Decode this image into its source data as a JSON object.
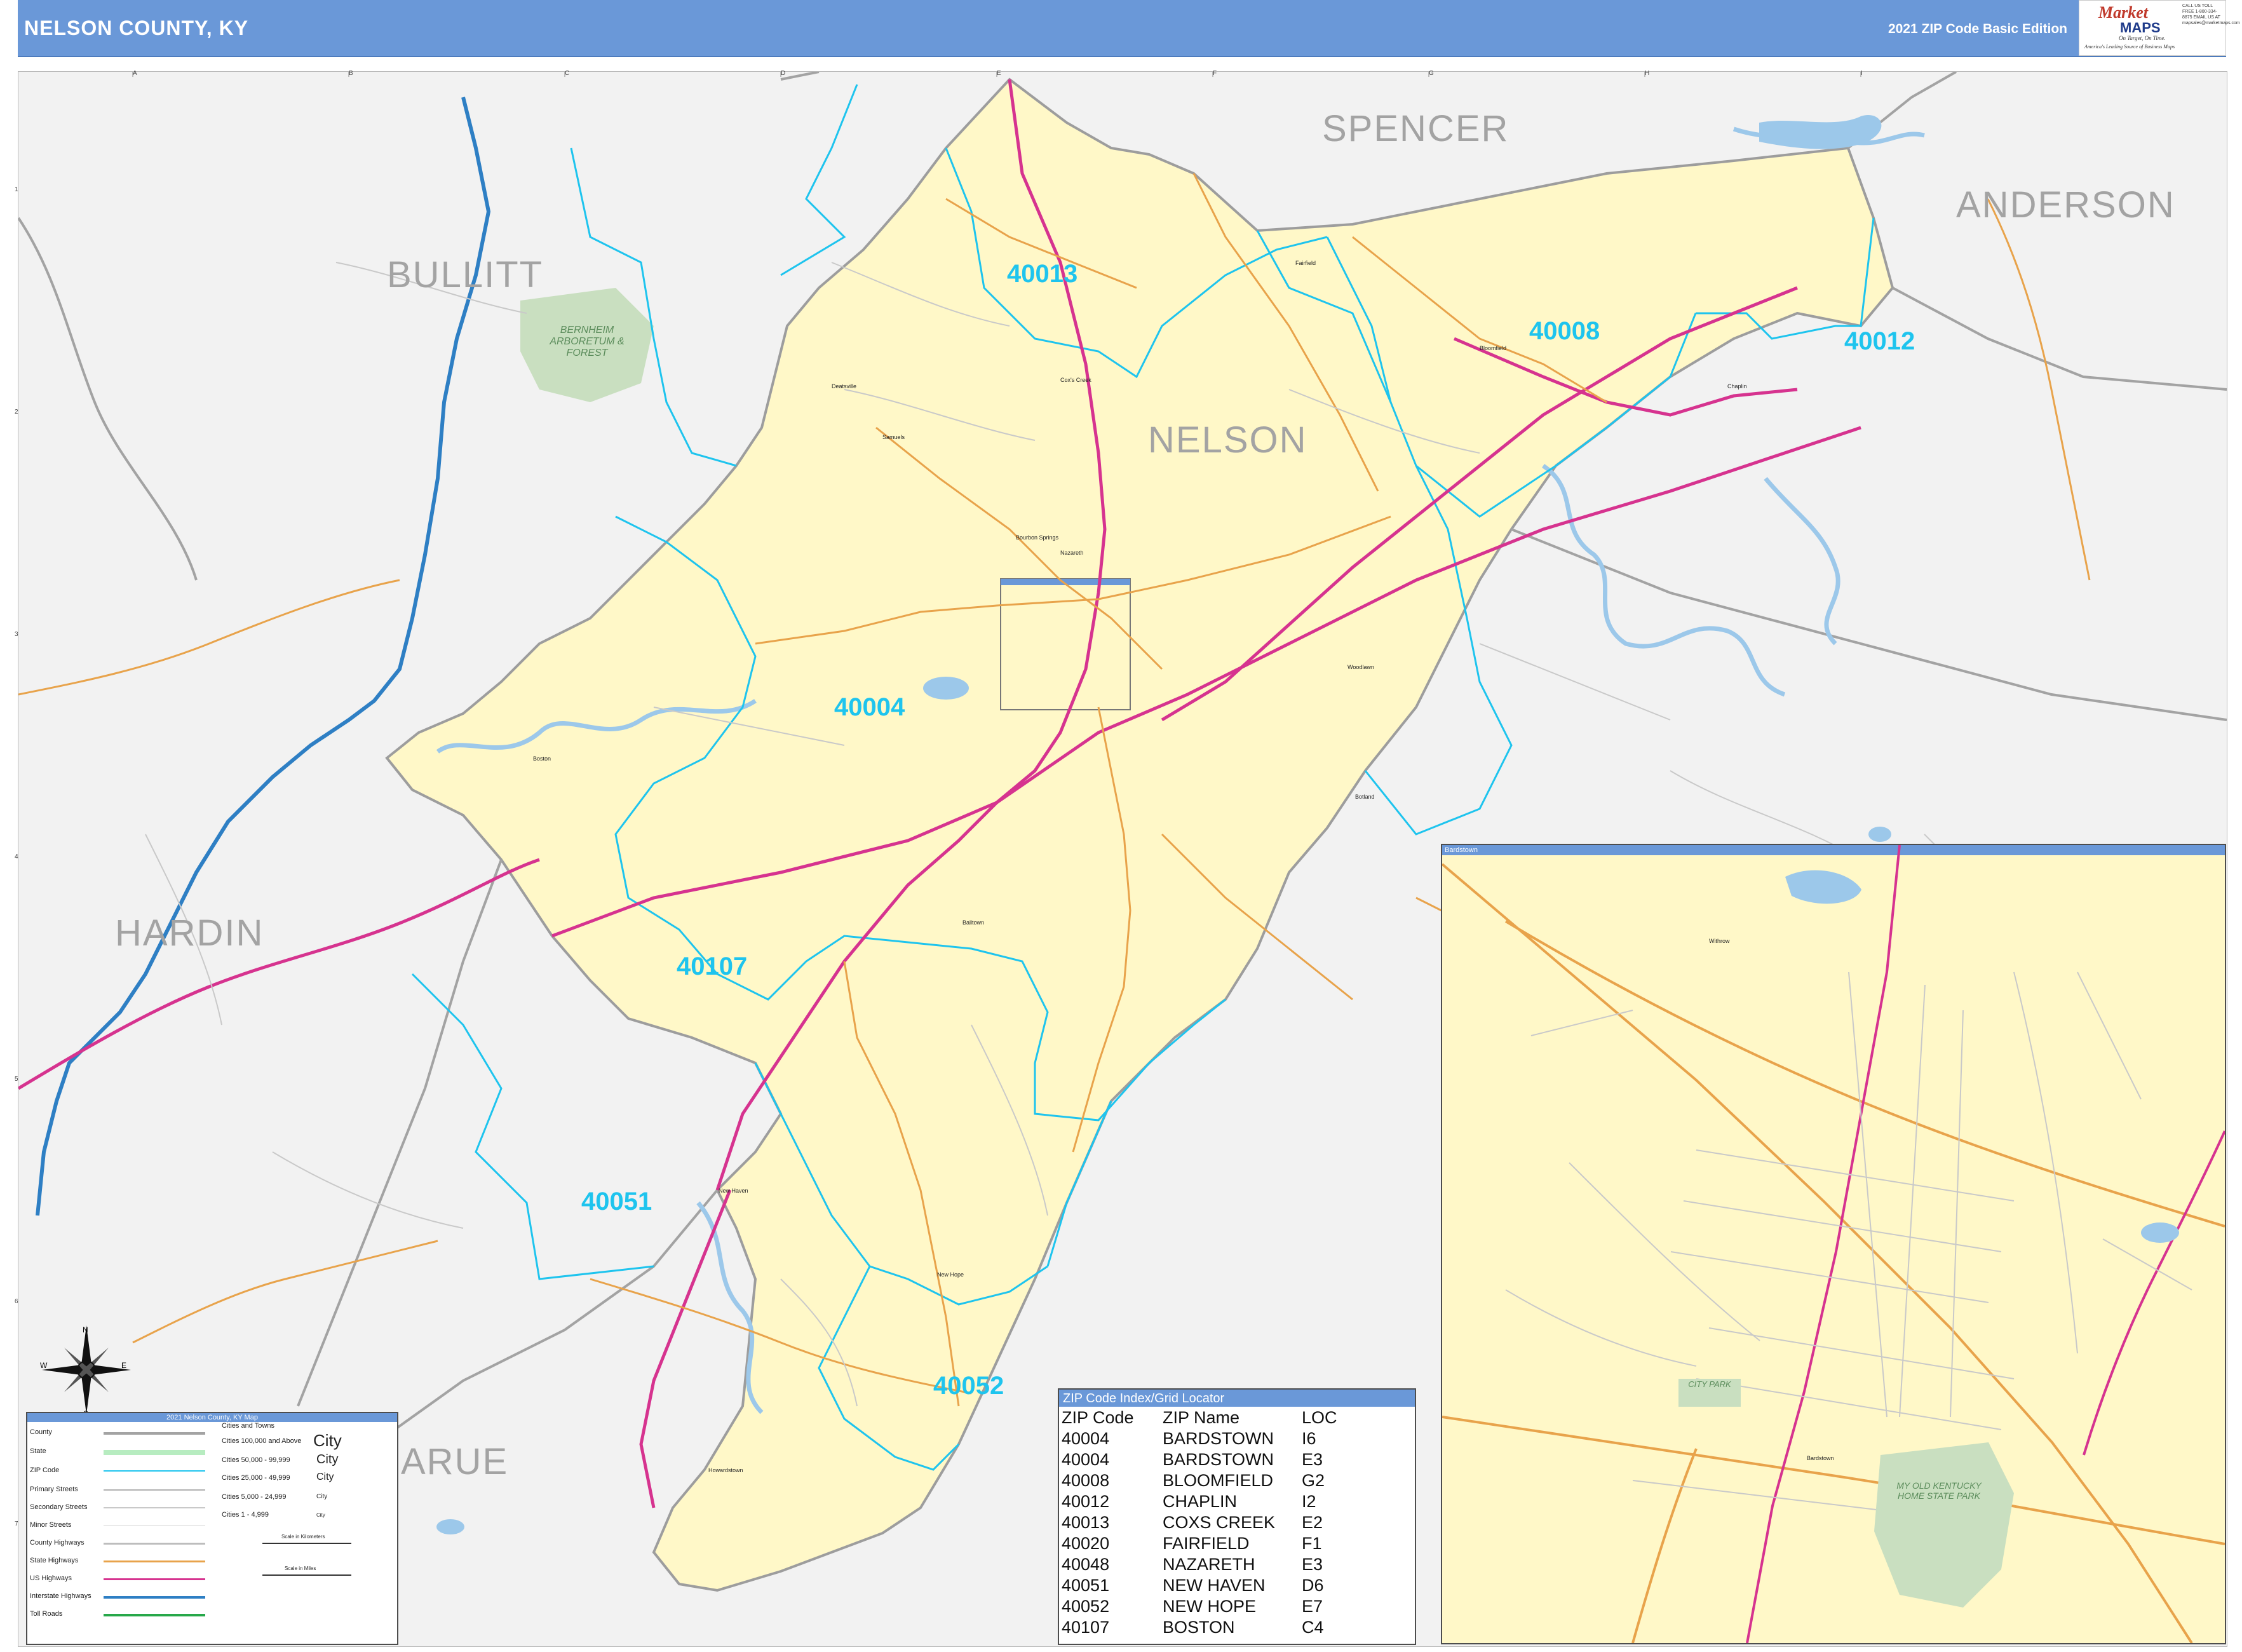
{
  "header": {
    "title": "NELSON COUNTY, KY",
    "edition": "2021 ZIP Code Basic Edition",
    "logo": {
      "brand": "Market",
      "brand2": "MAPS",
      "tagline": "On Target, On Time.",
      "tagline2": "America's Leading Source of Business Maps",
      "contact": "CALL US TOLL FREE 1-800-334-8875 EMAIL US AT mapsales@marketmaps.com"
    }
  },
  "grid": {
    "columns": [
      "A",
      "B",
      "C",
      "D",
      "E",
      "F",
      "G",
      "H",
      "I"
    ],
    "rows": [
      "1",
      "2",
      "3",
      "4",
      "5",
      "6",
      "7"
    ]
  },
  "counties": [
    {
      "id": "spencer",
      "name": "SPENCER"
    },
    {
      "id": "anderson",
      "name": "ANDERSON"
    },
    {
      "id": "bullitt",
      "name": "BULLITT"
    },
    {
      "id": "nelson",
      "name": "NELSON"
    },
    {
      "id": "hardin",
      "name": "HARDIN"
    },
    {
      "id": "larue",
      "name": "ARUE"
    }
  ],
  "zip_labels": [
    "40013",
    "40008",
    "40012",
    "40004",
    "40107",
    "40051",
    "40052"
  ],
  "parks": {
    "bernheim": "BERNHEIM ARBORETUM & FOREST",
    "city_park": "CITY PARK",
    "my_old_kentucky": "MY OLD KENTUCKY HOME STATE PARK"
  },
  "towns": {
    "fairfield": "Fairfield",
    "bloomfield": "Bloomfield",
    "chaplin": "Chaplin",
    "deatsville": "Deatsville",
    "coxs_creek": "Cox's Creek",
    "samuels": "Samuels",
    "boston_springs": "Bourbon Springs",
    "nazareth": "Nazareth",
    "boston": "Boston",
    "balltown": "Balltown",
    "new_haven": "New Haven",
    "new_hope": "New Hope",
    "howardstown": "Howardstown",
    "botland": "Botland",
    "woodlawn": "Woodlawn",
    "bardstown_inset": "Bardstown",
    "withrow": "Withrow"
  },
  "inset": {
    "title": "Bardstown"
  },
  "zip_index": {
    "title": "ZIP Code Index/Grid Locator",
    "columns": [
      "ZIP Code",
      "ZIP Name",
      "LOC"
    ],
    "rows": [
      [
        "40004",
        "BARDSTOWN",
        "I6"
      ],
      [
        "40004",
        "BARDSTOWN",
        "E3"
      ],
      [
        "40008",
        "BLOOMFIELD",
        "G2"
      ],
      [
        "40012",
        "CHAPLIN",
        "I2"
      ],
      [
        "40013",
        "COXS CREEK",
        "E2"
      ],
      [
        "40020",
        "FAIRFIELD",
        "F1"
      ],
      [
        "40048",
        "NAZARETH",
        "E3"
      ],
      [
        "40051",
        "NEW HAVEN",
        "D6"
      ],
      [
        "40052",
        "NEW HOPE",
        "E7"
      ],
      [
        "40107",
        "BOSTON",
        "C4"
      ]
    ]
  },
  "legend": {
    "title": "2021 Nelson County, KY Map",
    "rows": [
      "County",
      "State",
      "ZIP Code",
      "Primary Streets",
      "Secondary Streets",
      "Minor Streets",
      "County Highways",
      "State Highways",
      "US Highways",
      "Interstate Highways",
      "Toll Roads"
    ],
    "cities_heading": "Cities and Towns",
    "cities": [
      {
        "range": "Cities 100,000 and Above",
        "sample": "City"
      },
      {
        "range": "Cities 50,000 - 99,999",
        "sample": "City"
      },
      {
        "range": "Cities 25,000 - 49,999",
        "sample": "City"
      },
      {
        "range": "Cities 5,000 - 24,999",
        "sample": "City"
      },
      {
        "range": "Cities 1 - 4,999",
        "sample": "City"
      }
    ],
    "scale_km": "Scale in Kilometers",
    "scale_mi": "Scale in Miles"
  },
  "colors": {
    "header": "#6a98d8",
    "county_fill": "#fff8c8",
    "outside_fill": "#f2f2f2",
    "zip_boundary": "#1ec4ee",
    "us_highway": "#d6338f",
    "state_highway": "#e8a34b",
    "interstate": "#2e7fc4",
    "water": "#9cc8ea",
    "park": "#c9dfc0"
  },
  "compass": {
    "n": "N",
    "s": "S",
    "e": "E",
    "w": "W"
  }
}
